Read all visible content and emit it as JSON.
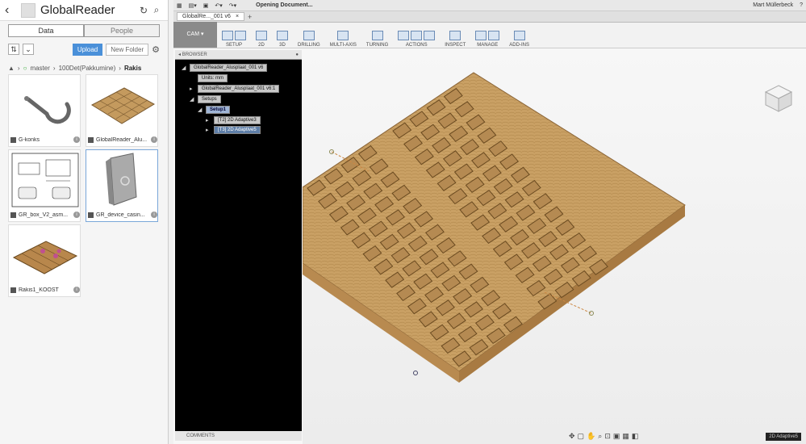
{
  "panel": {
    "title": "GlobalReader",
    "tabs": {
      "data": "Data",
      "people": "People"
    },
    "upload": "Upload",
    "new_folder": "New Folder",
    "breadcrumb": {
      "branch": "master",
      "folder": "100Det(Pakkumine)",
      "current": "Rakis"
    },
    "items": [
      {
        "name": "G-konks"
      },
      {
        "name": "GlobalReader_Alu..."
      },
      {
        "name": "GR_box_V2_asm..."
      },
      {
        "name": "GR_device_casin..."
      },
      {
        "name": "Rakis1_KOOST"
      }
    ]
  },
  "app": {
    "status": "Opening Document...",
    "user": "Mart Müllerbeck",
    "doc_tab": "GlobalRe..._001 v6",
    "workspace": "CAM",
    "ribbon": [
      "SETUP",
      "2D",
      "3D",
      "DRILLING",
      "MULTI-AXIS",
      "TURNING",
      "ACTIONS",
      "INSPECT",
      "MANAGE",
      "ADD-INS"
    ],
    "browser": {
      "title": "BROWSER",
      "root": "GlobalReader_Alusplaat_001 v6",
      "units": "Units: mm",
      "component": "GlobalReader_Alusplaat_001 v6:1",
      "setups": "Setups",
      "setup": "Setup1",
      "op1": "[T2] 2D Adaptive3",
      "op2": "[T3] 2D Adaptive5"
    },
    "comments": "COMMENTS",
    "op_badge": "2D Adaptive5"
  },
  "colors": {
    "accent": "#4a90d9",
    "wood": "#c49a5e"
  }
}
